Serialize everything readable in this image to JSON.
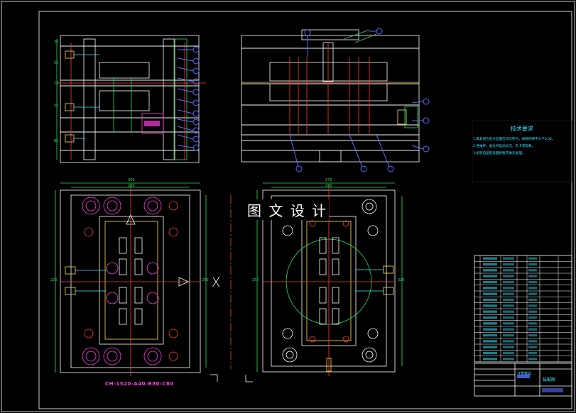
{
  "watermark": "图 文 设 计",
  "bottom_label": "CH-1520-A40-B80-C80",
  "dims": {
    "a1": "300",
    "a2": "260",
    "b1": "270",
    "b2": "250",
    "left_side_1": "220",
    "left_side_2": "250",
    "right_side_1": "250",
    "right_side_2": "220"
  },
  "tech_title": "技术要求",
  "tech_lines": [
    "1.模具闭合后分型面应均匀密合，局部间隙不大于0.02。",
    "2.各推杆、复位杆运动灵活，无卡滞现象。",
    "3.组装后型腔表面按要求抛光处理。"
  ],
  "bom_rows": 18,
  "title_block_labels": [
    "注塑模具",
    "装配图"
  ],
  "section_mark": "X",
  "colors": {
    "line": "#ffffff",
    "hatch": "#ffffff",
    "red": "#ff3b3b",
    "yellow": "#ffe14a",
    "green": "#27e060",
    "blue": "#5a6cff",
    "cyan": "#38e8ff",
    "magenta": "#ff3fe0"
  }
}
